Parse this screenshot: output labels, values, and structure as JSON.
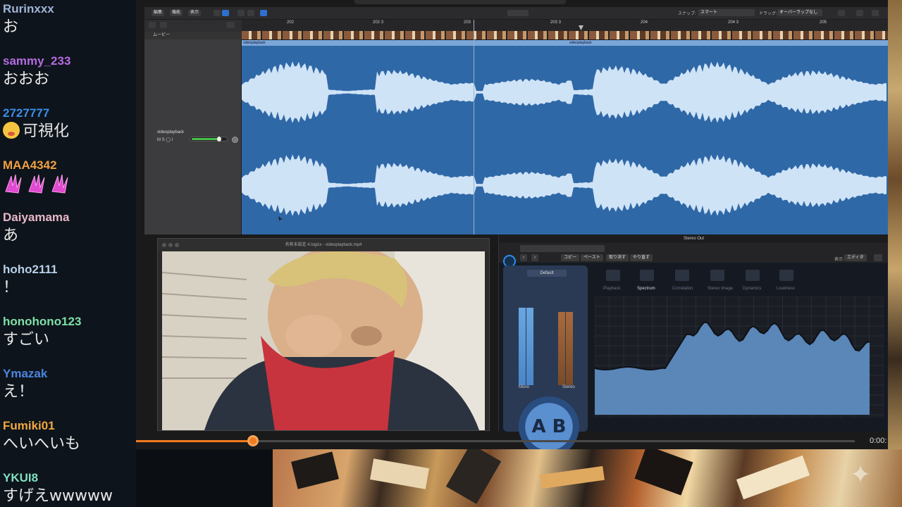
{
  "chat": {
    "messages": [
      {
        "user": "Rurinxxx",
        "color": "#9fb4d8",
        "text": "お"
      },
      {
        "user": "sammy_233",
        "color": "#b46ce0",
        "text": "おおお"
      },
      {
        "user": "2727777",
        "color": "#3b8ee8",
        "text": "可視化",
        "emoji": "flushed-face"
      },
      {
        "user": "MAA4342",
        "color": "#f0a040",
        "text": "",
        "emoji": "pink-wings"
      },
      {
        "user": "Daiyamama",
        "color": "#e8b8c8",
        "text": "あ"
      },
      {
        "user": "hoho2111",
        "color": "#b8d0e8",
        "text": "！"
      },
      {
        "user": "honohono123",
        "color": "#7ee0a8",
        "text": "すごい"
      },
      {
        "user": "Ymazak",
        "color": "#4a86e0",
        "text": "え！"
      },
      {
        "user": "Fumiki01",
        "color": "#f0a840",
        "text": "へいへいも"
      },
      {
        "user": "YKUI8",
        "color": "#7ee0c0",
        "text": "すげえwwwww"
      }
    ]
  },
  "daw": {
    "snap_label": "スナップ:",
    "snap_value": "スマート",
    "drag_label": "ドラッグ:",
    "drag_value": "オーバーラップなし",
    "toolbar_buttons": [
      "編集",
      "機能",
      "表示"
    ],
    "movie_track_label": "ムービー",
    "track_name": "videoplayback",
    "track_buttons": "M  S  ◯  I",
    "region_name": "videoplayback",
    "ruler_ticks": [
      "202",
      "202 3",
      "203",
      "203 3",
      "204",
      "204 3",
      "205"
    ]
  },
  "video_window": {
    "title": "名称未設定 4.logicx - videoplayback.mp4"
  },
  "plugin": {
    "window_title": "Stereo Out",
    "copy_label": "コピー",
    "paste_label": "ペースト",
    "undo_label": "取り消す",
    "redo_label": "やり直す",
    "view_label": "表示:",
    "view_value": "エディタ",
    "default_tab": "Default",
    "mono_label": "Mono",
    "stereo_label": "Stereo",
    "ab_label": "A B",
    "tabs": [
      {
        "label": "Playback",
        "icon": "waveform-icon"
      },
      {
        "label": "Spectrum",
        "icon": "spectrum-icon",
        "active": true
      },
      {
        "label": "Correlation",
        "icon": "bars-icon"
      },
      {
        "label": "Stereo Image",
        "icon": "funnel-icon"
      },
      {
        "label": "Dynamics",
        "icon": "vu-icon"
      },
      {
        "label": "Loudness",
        "icon": "meter-icon"
      }
    ]
  },
  "player": {
    "time": "0:00:",
    "progress_fraction": 0.163
  },
  "colors": {
    "accent": "#f07b20",
    "waveform_bg": "#2f68a7",
    "waveform": "#cfe3f7"
  }
}
